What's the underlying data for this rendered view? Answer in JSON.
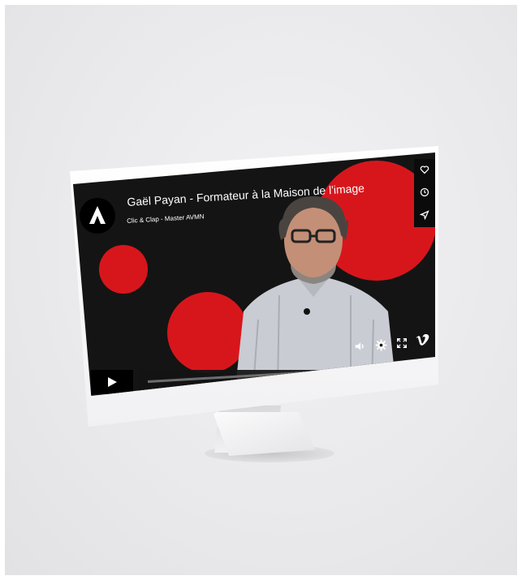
{
  "video": {
    "title": "Gaël Payan - Formateur à la Maison de l'image",
    "subtitle": "Clic & Clap - Master AVMN"
  },
  "icons": {
    "logo": "channel-logo-icon",
    "like": "heart-icon",
    "watch_later": "clock-icon",
    "share": "send-icon",
    "play": "play-icon",
    "volume": "volume-icon",
    "settings": "gear-icon",
    "fullscreen": "fullscreen-icon",
    "vimeo": "vimeo-logo-icon"
  },
  "colors": {
    "accent": "#d7161c",
    "background": "#141414",
    "controls": "#000000"
  }
}
